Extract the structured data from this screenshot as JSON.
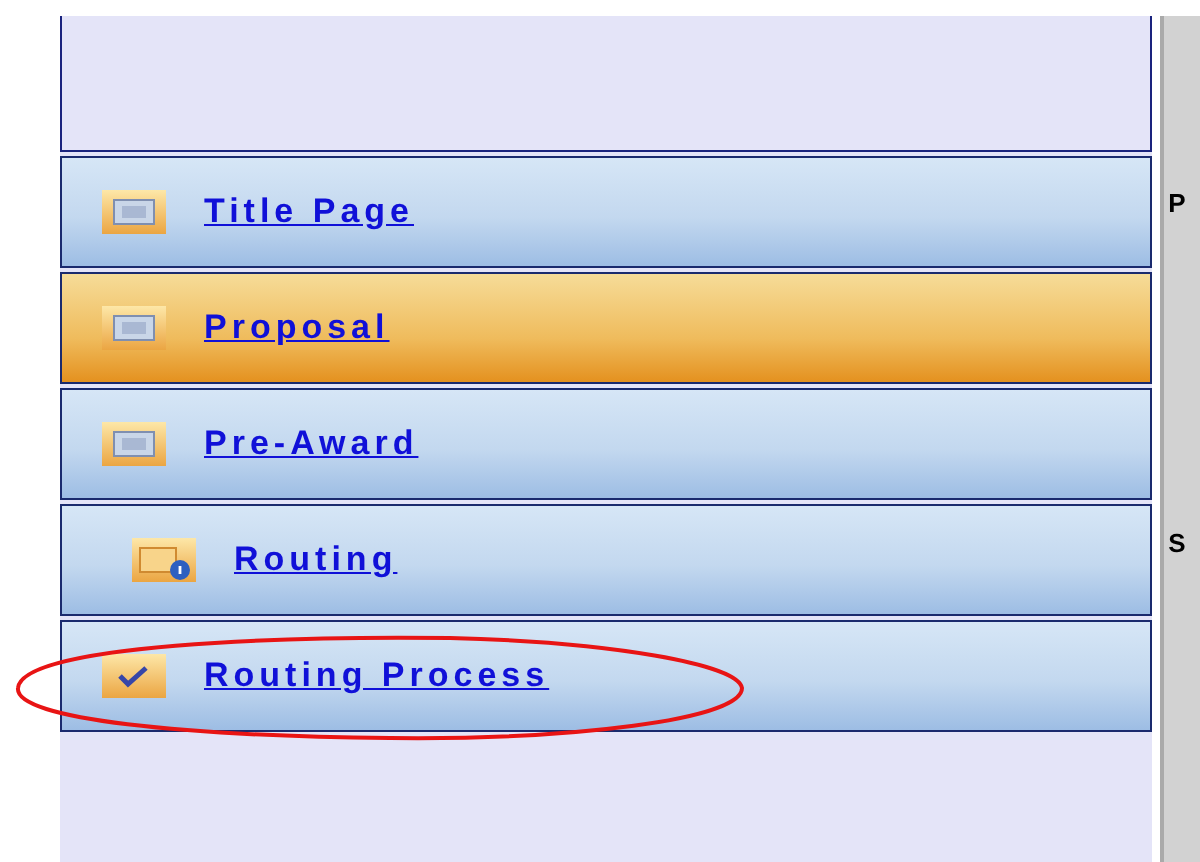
{
  "nav": {
    "items": [
      {
        "label": "Title Page",
        "kind": "page",
        "selected": false
      },
      {
        "label": "Proposal",
        "kind": "page",
        "selected": true
      },
      {
        "label": "Pre-Award",
        "kind": "page",
        "selected": false,
        "children": [
          {
            "label": "Routing",
            "kind": "info",
            "selected": false
          }
        ]
      },
      {
        "label": "Routing Process",
        "kind": "check",
        "selected": false,
        "highlighted": true
      }
    ]
  },
  "side_panel": {
    "letters": [
      "P",
      "S"
    ]
  }
}
